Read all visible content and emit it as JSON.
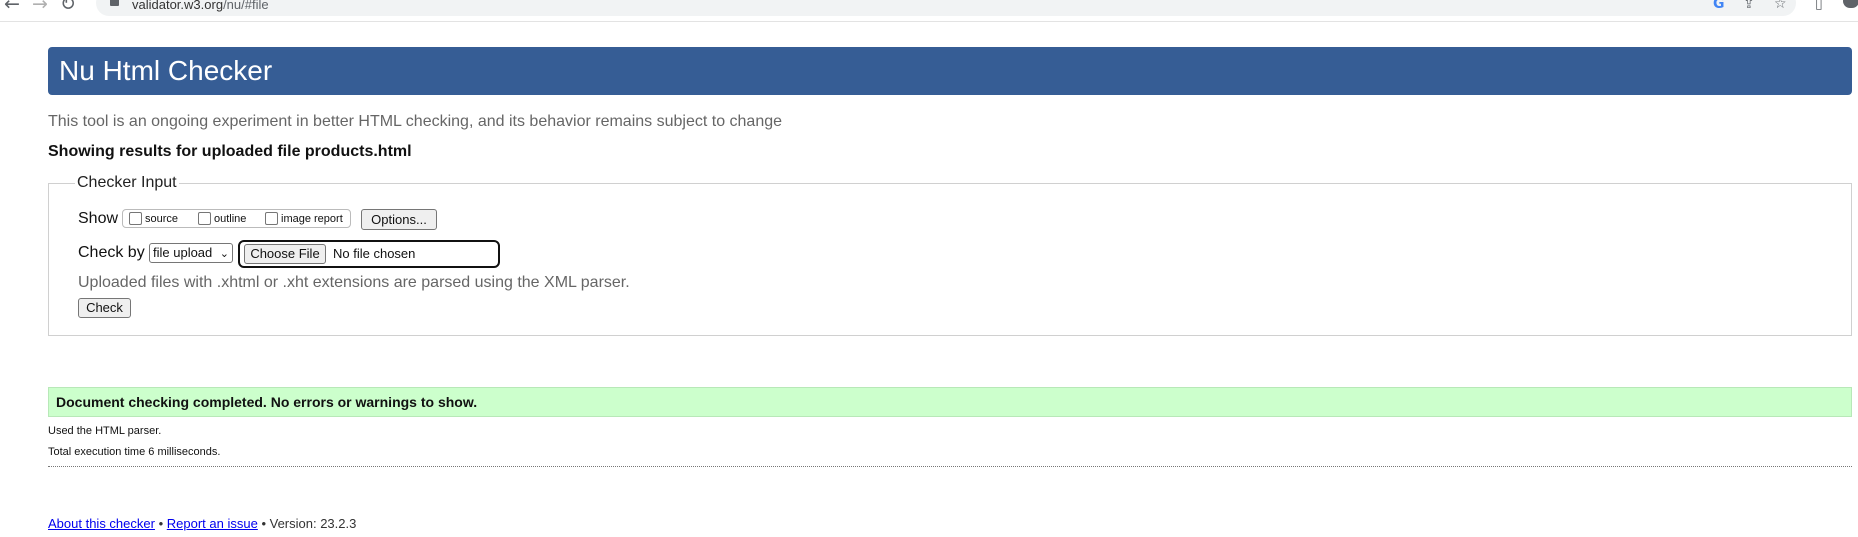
{
  "browser": {
    "url_host": "validator.w3.org",
    "url_path": "/nu/#file",
    "back_icon": "back-arrow-icon",
    "forward_icon": "forward-arrow-icon",
    "reload_icon": "reload-icon"
  },
  "header": {
    "title": "Nu Html Checker"
  },
  "subtitle": "This tool is an ongoing experiment in better HTML checking, and its behavior remains subject to change",
  "showing": "Showing results for uploaded file products.html",
  "checker": {
    "legend": "Checker Input",
    "show_label": "Show",
    "options": [
      {
        "label": "source",
        "checked": false
      },
      {
        "label": "outline",
        "checked": false
      },
      {
        "label": "image report",
        "checked": false
      }
    ],
    "options_button": "Options...",
    "check_by_label": "Check by",
    "check_by_value": "file upload",
    "choose_file_button": "Choose File",
    "no_file_text": "No file chosen",
    "hint": "Uploaded files with .xhtml or .xht extensions are parsed using the XML parser.",
    "check_button": "Check"
  },
  "result": {
    "message": "Document checking completed. No errors or warnings to show.",
    "parser": "Used the HTML parser.",
    "time": "Total execution time 6 milliseconds."
  },
  "footer": {
    "about_link": "About this checker",
    "separator": "•",
    "issue_link": "Report an issue",
    "version": "• Version: 23.2.3"
  },
  "colors": {
    "header_bg": "#365d95",
    "success_bg": "#ccffcc",
    "link": "#0000ee"
  }
}
